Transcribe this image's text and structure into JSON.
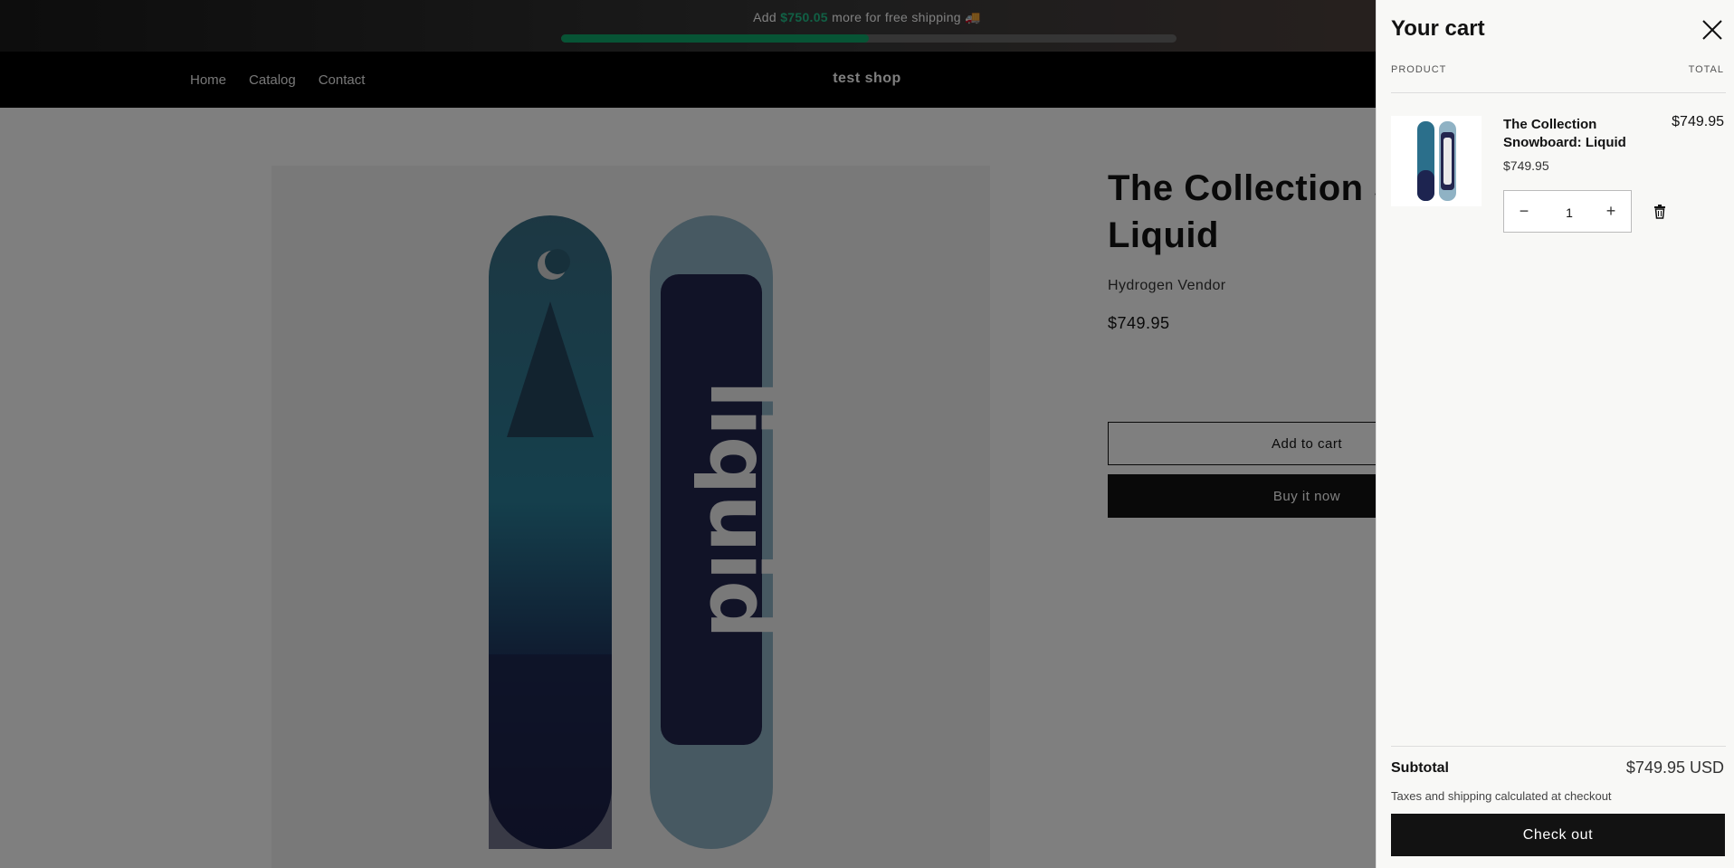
{
  "announcement": {
    "prefix": "Add",
    "amount": "$750.05",
    "suffix": "more for free shipping 🚚",
    "progress_fraction": 0.5,
    "fill_color": "#0fa86b"
  },
  "header": {
    "nav": [
      {
        "label": "Home"
      },
      {
        "label": "Catalog"
      },
      {
        "label": "Contact"
      }
    ],
    "logo": "test shop"
  },
  "product": {
    "title": "The Collection Snowboard: Liquid",
    "vendor": "Hydrogen Vendor",
    "price": "$749.95",
    "add_to_cart": "Add to cart",
    "buy_now": "Buy it now",
    "image_icon": "snowboard-image"
  },
  "cart": {
    "title": "Your cart",
    "close_icon": "close-icon",
    "col_product": "PRODUCT",
    "col_total": "TOTAL",
    "items": [
      {
        "title": "The Collection Snowboard: Liquid",
        "unit_price": "$749.95",
        "line_total": "$749.95",
        "quantity": "1",
        "decrease_icon": "minus-icon",
        "increase_icon": "plus-icon",
        "remove_icon": "trash-icon"
      }
    ],
    "subtotal_label": "Subtotal",
    "subtotal_value": "$749.95 USD",
    "tax_note": "Taxes and shipping calculated at checkout",
    "checkout": "Check out"
  }
}
